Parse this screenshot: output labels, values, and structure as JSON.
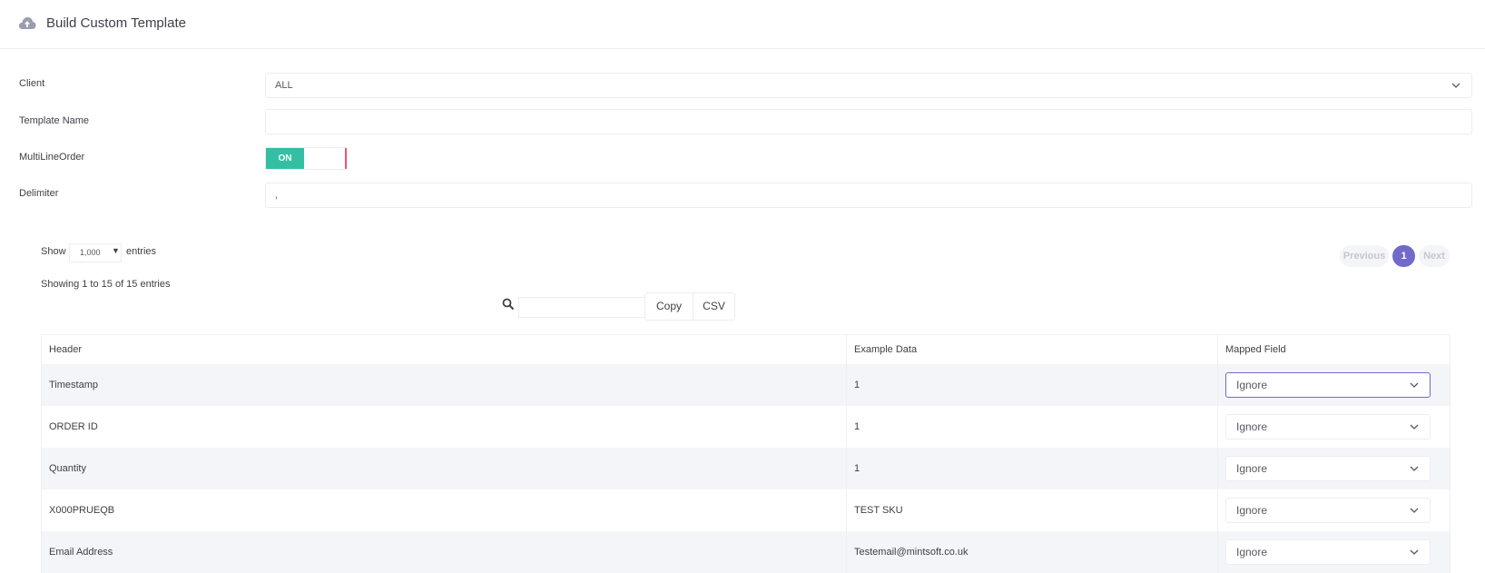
{
  "header": {
    "title": "Build Custom Template",
    "icon": "cloud-upload-icon"
  },
  "form": {
    "client_label": "Client",
    "client_value": "ALL",
    "template_name_label": "Template Name",
    "template_name_value": "",
    "multiline_label": "MultiLineOrder",
    "multiline_toggle": "ON",
    "delimiter_label": "Delimiter",
    "delimiter_value": ","
  },
  "datatable": {
    "show_label": "Show",
    "length_value": "1,000",
    "entries_label": "entries",
    "info": "Showing 1 to 15 of 15 entries",
    "pagination": {
      "previous": "Previous",
      "current": "1",
      "next": "Next"
    },
    "buttons": {
      "copy": "Copy",
      "csv": "CSV"
    },
    "columns": [
      "Header",
      "Example Data",
      "Mapped Field"
    ],
    "rows": [
      {
        "header": "Timestamp",
        "example": "1",
        "mapped": "Ignore"
      },
      {
        "header": "ORDER ID",
        "example": "1",
        "mapped": "Ignore"
      },
      {
        "header": "Quantity",
        "example": "1",
        "mapped": "Ignore"
      },
      {
        "header": "X000PRUEQB",
        "example": "TEST SKU",
        "mapped": "Ignore"
      },
      {
        "header": "Email Address",
        "example": "Testemail@mintsoft.co.uk",
        "mapped": "Ignore"
      }
    ]
  },
  "colors": {
    "accent": "#716aca",
    "toggle_on": "#34bfa3",
    "toggle_handle": "#f4516c"
  }
}
